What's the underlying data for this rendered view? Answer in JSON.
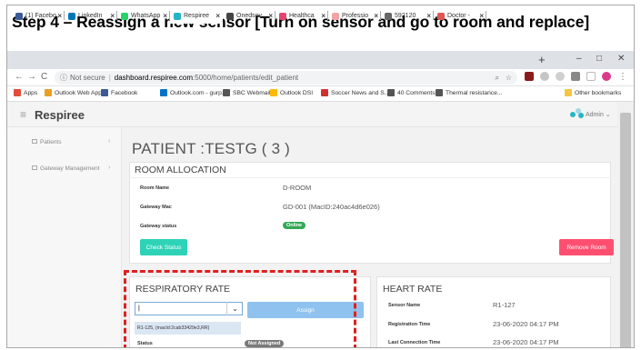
{
  "slide": {
    "step_title": "Step 4 – Reassign a new sensor [Turn on sensor and go to room and replace]"
  },
  "browser": {
    "tabs": [
      {
        "label": "(1) Facebo",
        "color": "#3b5998"
      },
      {
        "label": "LinkedIn",
        "color": "#0077b5"
      },
      {
        "label": "WhatsApp",
        "color": "#25d366"
      },
      {
        "label": "Respiree",
        "color": "#26b5c8",
        "active": true
      },
      {
        "label": "Onedsov",
        "color": "#444444"
      },
      {
        "label": "Healthca",
        "color": "#e2466e"
      },
      {
        "label": "Professio",
        "color": "#f4a3a3"
      },
      {
        "label": "592120",
        "color": "#666666"
      },
      {
        "label": "Doctor -",
        "color": "#e05555"
      }
    ],
    "new_tab": "+",
    "window_controls": [
      "–",
      "□",
      "✕"
    ],
    "nav": {
      "back": "←",
      "forward": "→",
      "reload": "C"
    },
    "address": {
      "security": "Not secure",
      "host": "dashboard.respiree.com",
      "path": ":5000/home/patients/edit_patient"
    },
    "bookmarks": [
      {
        "label": "Apps",
        "color": "#e24b3b"
      },
      {
        "label": "Outlook Web App",
        "color": "#e8a020"
      },
      {
        "label": "Facebook",
        "color": "#3b5998"
      },
      {
        "label": "Outlook.com - gurp...",
        "color": "#0072c6"
      },
      {
        "label": "SBC Webmail",
        "color": "#555555"
      },
      {
        "label": "Outlook DSI",
        "color": "#ffb900"
      },
      {
        "label": "Soccer News and S...",
        "color": "#d32f2f"
      },
      {
        "label": "40 Comments",
        "color": "#555555"
      },
      {
        "label": "Thermal resistance...",
        "color": "#555555"
      }
    ],
    "other_bookmarks": "Other bookmarks"
  },
  "app": {
    "brand": "Respiree",
    "user": "Admin",
    "sidebar": [
      {
        "label": "Patients"
      },
      {
        "label": "Gateway Management"
      }
    ]
  },
  "page": {
    "title": "PATIENT :TESTG ( 3 )",
    "room": {
      "heading": "ROOM ALLOCATION",
      "room_name_label": "Room Name",
      "room_name": "D-ROOM",
      "gateway_mac_label": "Gateway Mac",
      "gateway_mac": "GD-001 (MacID:240ac4d6e026)",
      "gateway_status_label": "Gateway status",
      "gateway_status": "Online",
      "check_status": "Check Status",
      "remove_room": "Remove Room"
    },
    "resp": {
      "heading": "RESPIRATORY RATE",
      "select_value": "|",
      "option": "R1-125, (macId:2cab33429e3,RR)",
      "assign": "Assign",
      "status_label": "Status",
      "status": "Not Assigned"
    },
    "heart": {
      "heading": "HEART RATE",
      "sensor_label": "Sensor Name",
      "sensor": "R1-127",
      "reg_label": "Registration Time",
      "reg": "23-06-2020 04:17 PM",
      "last_label": "Last Connection Time",
      "last": "23-06-2020 04:17 PM"
    }
  },
  "colors": {
    "online": "#34a853",
    "check": "#2ed3b7",
    "remove": "#ff4f70",
    "assign": "#8fc2ee",
    "badge_gray": "#7a7a7a",
    "highlight": "#e02020"
  }
}
